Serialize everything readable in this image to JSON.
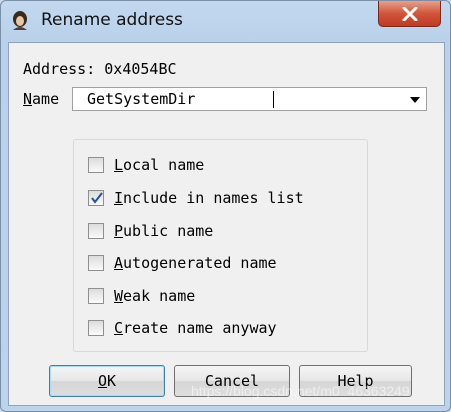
{
  "window": {
    "title": "Rename address",
    "close_label": "X"
  },
  "dialog": {
    "address_label": "Address: 0x4054BC",
    "name_label_mnemonic": "N",
    "name_label_rest": "ame",
    "name_value": "GetSystemDir"
  },
  "options": [
    {
      "mnemonic": "L",
      "rest": "ocal name",
      "checked": false
    },
    {
      "mnemonic": "I",
      "rest": "nclude in names list",
      "checked": true
    },
    {
      "mnemonic": "P",
      "rest": "ublic name",
      "checked": false
    },
    {
      "mnemonic": "A",
      "rest": "utogenerated name",
      "checked": false
    },
    {
      "mnemonic": "W",
      "rest": "eak name",
      "checked": false
    },
    {
      "mnemonic": "C",
      "rest": "reate name anyway",
      "checked": false
    }
  ],
  "buttons": {
    "ok_mnemonic": "O",
    "ok_rest": "K",
    "cancel": "Cancel",
    "help": "Help"
  },
  "watermark": "https://blog.csdn.net/m0_46363249",
  "colors": {
    "frame": "#c3d8ef",
    "close": "#c03a20",
    "check": "#2a4f9a"
  }
}
